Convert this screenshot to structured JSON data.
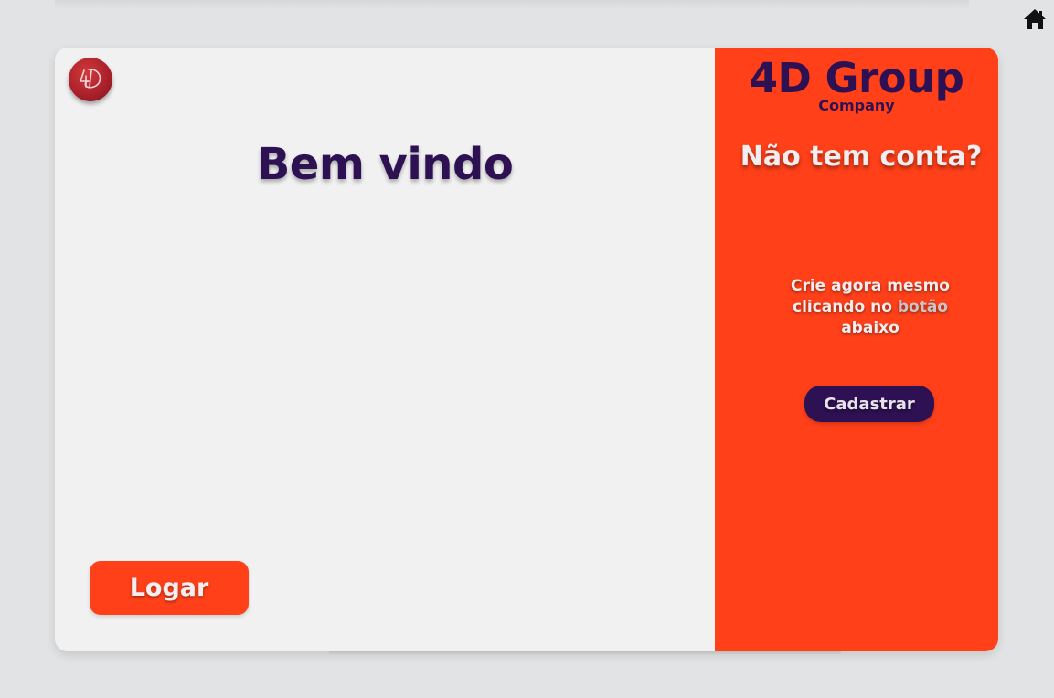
{
  "colors": {
    "background": "#e2e3e4",
    "left_panel": "#f1f1f2",
    "accent_orange": "#ff4019",
    "brand_purple": "#2e1152",
    "light_text": "#f4eef0"
  },
  "nav": {
    "home_icon": "home-icon"
  },
  "logo": {
    "icon": "4d-logo-badge",
    "text": "4D"
  },
  "login_panel": {
    "title": "Bem vindo",
    "login_button": "Logar"
  },
  "signup_panel": {
    "brand_name": "4D Group",
    "brand_sub": "Company",
    "question": "Não tem conta?",
    "text_part1": "Crie agora mesmo clicando no ",
    "text_highlight": "botão",
    "text_part2": " abaixo",
    "signup_button": "Cadastrar"
  }
}
